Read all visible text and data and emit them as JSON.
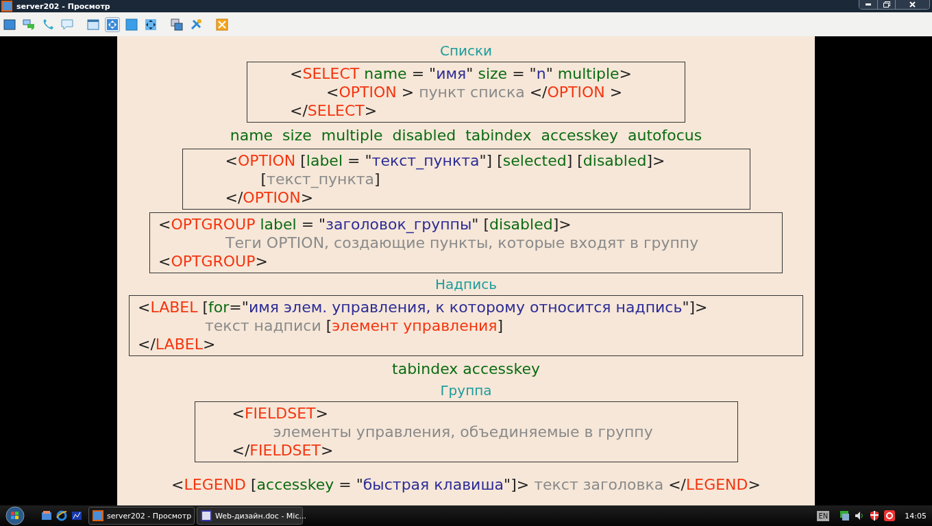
{
  "window": {
    "title": "server202 - Просмотр"
  },
  "toolbar": [
    {
      "selected": false
    },
    {
      "selected": false
    },
    {
      "selected": false
    },
    {
      "selected": false
    },
    {
      "selected": false
    },
    {
      "selected": true
    },
    {
      "selected": false
    },
    {
      "selected": false
    },
    {
      "selected": false
    },
    {
      "selected": false
    },
    {
      "selected": false
    }
  ],
  "slide": {
    "blocks": [
      {
        "kind": "heading",
        "text": "Списки"
      },
      {
        "kind": "code_box",
        "lines": [
          {
            "segments": [
              {
                "kind": "punct",
                "text": "<"
              },
              {
                "kind": "tag",
                "text": "SELECT"
              },
              {
                "kind": "attr",
                "text": " name"
              },
              {
                "kind": "punct",
                "text": " = \""
              },
              {
                "kind": "value",
                "text": "имя"
              },
              {
                "kind": "punct",
                "text": "\" "
              },
              {
                "kind": "attr",
                "text": "size"
              },
              {
                "kind": "punct",
                "text": " = \""
              },
              {
                "kind": "value",
                "text": "n"
              },
              {
                "kind": "punct",
                "text": "\" "
              },
              {
                "kind": "attr",
                "text": "multiple"
              },
              {
                "kind": "punct",
                "text": ">"
              }
            ],
            "children": [
              {
                "segments": [
                  {
                    "kind": "punct",
                    "text": "<"
                  },
                  {
                    "kind": "tag",
                    "text": "OPTION"
                  },
                  {
                    "kind": "punct",
                    "text": " > "
                  },
                  {
                    "kind": "text",
                    "text": "пункт списка"
                  },
                  {
                    "kind": "punct",
                    "text": " </"
                  },
                  {
                    "kind": "tag",
                    "text": "OPTION"
                  },
                  {
                    "kind": "punct",
                    "text": " >"
                  }
                ]
              }
            ]
          },
          {
            "segments": [
              {
                "kind": "punct",
                "text": "</"
              },
              {
                "kind": "tag",
                "text": "SELECT"
              },
              {
                "kind": "punct",
                "text": ">"
              }
            ]
          }
        ]
      },
      {
        "kind": "attributes",
        "text": "name  size  multiple  disabled  tabindex  accesskey  autofocus"
      },
      {
        "kind": "code_box",
        "lines": [
          {
            "segments": [
              {
                "kind": "punct",
                "text": "<"
              },
              {
                "kind": "tag",
                "text": "OPTION"
              },
              {
                "kind": "punct",
                "text": " ["
              },
              {
                "kind": "attr",
                "text": "label"
              },
              {
                "kind": "punct",
                "text": " = \""
              },
              {
                "kind": "value",
                "text": "текст_пункта"
              },
              {
                "kind": "punct",
                "text": "\"] ["
              },
              {
                "kind": "attr",
                "text": "selected"
              },
              {
                "kind": "punct",
                "text": "] ["
              },
              {
                "kind": "attr",
                "text": "disabled"
              },
              {
                "kind": "punct",
                "text": "]>"
              }
            ],
            "children": [
              {
                "segments": [
                  {
                    "kind": "punct",
                    "text": "["
                  },
                  {
                    "kind": "text",
                    "text": "текст_пункта"
                  },
                  {
                    "kind": "punct",
                    "text": "]"
                  }
                ]
              }
            ]
          },
          {
            "segments": [
              {
                "kind": "punct",
                "text": "</"
              },
              {
                "kind": "tag",
                "text": "OPTION"
              },
              {
                "kind": "punct",
                "text": ">"
              }
            ]
          }
        ]
      },
      {
        "kind": "code_box",
        "lines": [
          {
            "segments": [
              {
                "kind": "punct",
                "text": "<"
              },
              {
                "kind": "tag",
                "text": "OPTGROUP"
              },
              {
                "kind": "attr",
                "text": " label"
              },
              {
                "kind": "punct",
                "text": " = \""
              },
              {
                "kind": "value",
                "text": "заголовок_группы"
              },
              {
                "kind": "punct",
                "text": "\" ["
              },
              {
                "kind": "attr",
                "text": "disabled"
              },
              {
                "kind": "punct",
                "text": "]>"
              }
            ],
            "children": [
              {
                "segments": [
                  {
                    "kind": "text",
                    "text": "Теги OPTION, создающие пункты, которые входят в группу"
                  }
                ]
              }
            ]
          },
          {
            "segments": [
              {
                "kind": "punct",
                "text": "<"
              },
              {
                "kind": "tag",
                "text": "OPTGROUP"
              },
              {
                "kind": "punct",
                "text": ">"
              }
            ]
          }
        ]
      },
      {
        "kind": "heading",
        "text": "Надпись"
      },
      {
        "kind": "code_box",
        "lines": [
          {
            "segments": [
              {
                "kind": "punct",
                "text": "<"
              },
              {
                "kind": "tag",
                "text": "LABEL"
              },
              {
                "kind": "punct",
                "text": " ["
              },
              {
                "kind": "attr",
                "text": "for"
              },
              {
                "kind": "punct",
                "text": "=\""
              },
              {
                "kind": "value",
                "text": "имя элем. управления, к которому относится надпись"
              },
              {
                "kind": "punct",
                "text": "\"]>"
              }
            ],
            "children": [
              {
                "segments": [
                  {
                    "kind": "text",
                    "text": "текст надписи "
                  },
                  {
                    "kind": "punct",
                    "text": "["
                  },
                  {
                    "kind": "tag",
                    "text": "элемент управления"
                  },
                  {
                    "kind": "punct",
                    "text": "]"
                  }
                ]
              }
            ]
          },
          {
            "segments": [
              {
                "kind": "punct",
                "text": "</"
              },
              {
                "kind": "tag",
                "text": "LABEL"
              },
              {
                "kind": "punct",
                "text": ">"
              }
            ]
          }
        ]
      },
      {
        "kind": "attributes",
        "text": "tabindex accesskey"
      },
      {
        "kind": "heading",
        "text": "Группа"
      },
      {
        "kind": "code_box",
        "lines": [
          {
            "segments": [
              {
                "kind": "punct",
                "text": "<"
              },
              {
                "kind": "tag",
                "text": "FIELDSET"
              },
              {
                "kind": "punct",
                "text": ">"
              }
            ],
            "children": [
              {
                "segments": [
                  {
                    "kind": "text",
                    "text": "элементы управления, объединяемые в группу"
                  }
                ]
              }
            ]
          },
          {
            "segments": [
              {
                "kind": "punct",
                "text": "</"
              },
              {
                "kind": "tag",
                "text": "FIELDSET"
              },
              {
                "kind": "punct",
                "text": ">"
              }
            ]
          }
        ]
      },
      {
        "kind": "code_line",
        "segments": [
          {
            "kind": "punct",
            "text": "<"
          },
          {
            "kind": "tag",
            "text": "LEGEND"
          },
          {
            "kind": "punct",
            "text": " ["
          },
          {
            "kind": "attr",
            "text": "accesskey"
          },
          {
            "kind": "punct",
            "text": " = \""
          },
          {
            "kind": "value",
            "text": "быстрая клавиша"
          },
          {
            "kind": "punct",
            "text": "\"]> "
          },
          {
            "kind": "text",
            "text": "текст заголовка"
          },
          {
            "kind": "punct",
            "text": " </"
          },
          {
            "kind": "tag",
            "text": "LEGEND"
          },
          {
            "kind": "punct",
            "text": ">"
          }
        ]
      }
    ]
  },
  "taskbar": {
    "tasks": [
      {
        "label": "server202 - Просмотр",
        "selected": true
      },
      {
        "label": "Web-дизайн.doc - Mic...",
        "selected": false
      }
    ],
    "language": "EN",
    "clock": "14:05"
  }
}
